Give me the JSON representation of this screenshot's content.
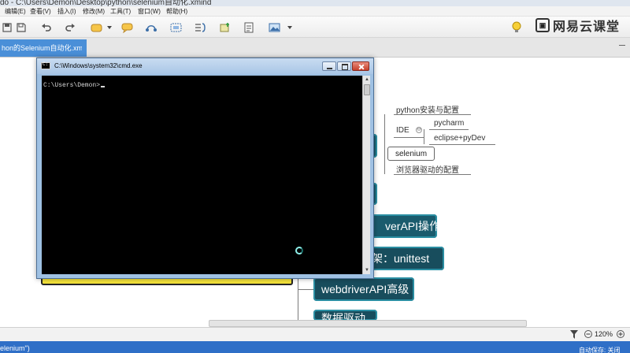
{
  "window": {
    "title": "do - C:\\Users\\Demon\\Desktop\\python\\selenium自动化.xmind"
  },
  "menu": {
    "items": [
      "编辑(E)",
      "查看(V)",
      "插入(I)",
      "修改(M)",
      "工具(T)",
      "窗口(W)",
      "帮助(H)"
    ]
  },
  "toolbar": {
    "icons": [
      "save-icon",
      "undo-icon",
      "redo-icon",
      "topic-icon",
      "callout-icon",
      "relationship-icon",
      "boundary-icon",
      "summary-icon",
      "marker-icon",
      "notes-icon",
      "image-icon",
      "lightbulb-icon"
    ],
    "watermark": "网易云课堂"
  },
  "tabs": {
    "active": "hon的Selenium自动化.xmind"
  },
  "mindmap": {
    "subtopics": {
      "python_setup": "python安装与配置",
      "ide": "IDE",
      "pycharm": "pycharm",
      "eclipse": "eclipse+pyDev",
      "selenium": "selenium",
      "driver_config": "浏览器驱动的配置"
    },
    "topics": {
      "webdriver_api_ops": "verAPI操作",
      "unittest": "框架：unittest",
      "webdriver_api_adv": "webdriverAPI高级",
      "data_driven": "数据驱动"
    }
  },
  "cmd": {
    "title": "C:\\Windows\\system32\\cmd.exe",
    "prompt": "C:\\Users\\Demon>"
  },
  "statusbar": {
    "zoom": "120%"
  },
  "taskbar": {
    "left_text": "elenium\")",
    "right_text": "自动保存: 关闭"
  },
  "colors": {
    "topic_fill": "#1a5b6d",
    "topic_border": "#2b8fa3",
    "tab_active": "#4a8fd8",
    "cmd_background": "#000000",
    "highlight_yellow": "#f3e23a"
  }
}
